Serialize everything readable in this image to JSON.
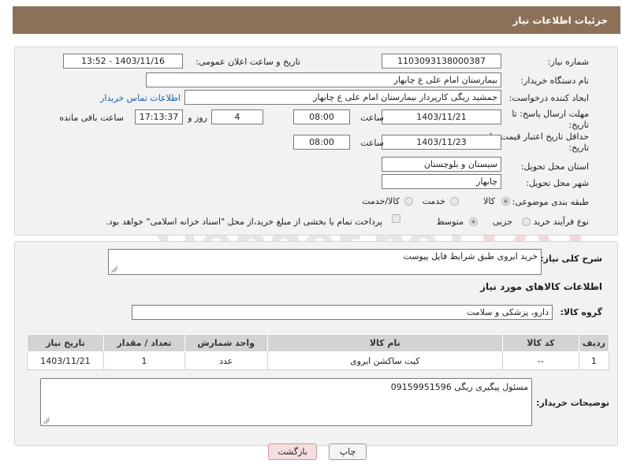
{
  "page": {
    "title": "جزئیات اطلاعات نیاز"
  },
  "form": {
    "need_number_label": "شماره نیاز:",
    "need_number": "1103093138000387",
    "announce_label": "تاریخ و ساعت اعلان عمومی:",
    "announce_value": "1403/11/16 - 13:52",
    "buyer_org_label": "نام دستگاه خریدار:",
    "buyer_org": "بیمارستان امام علی  ع  چابهار",
    "creator_label": "ایجاد کننده درخواست:",
    "creator": "جمشید ریگی کارپرداز بیمارستان امام علی  ع  چابهار",
    "contact_link": "اطلاعات تماس خریدار",
    "reply_deadline_label_1": "مهلت ارسال پاسخ: تا",
    "reply_deadline_label_2": "تاریخ:",
    "reply_date": "1403/11/21",
    "time_label": "ساعت",
    "reply_time": "08:00",
    "days_value": "4",
    "days_label": "روز و",
    "remaining_time": "17:13:37",
    "remaining_label": "ساعت باقی مانده",
    "price_deadline_label_1": "حداقل تاریخ اعتبار قیمت: تا",
    "price_deadline_label_2": "تاریخ:",
    "price_date": "1403/11/23",
    "price_time": "08:00",
    "province_label": "استان محل تحویل:",
    "province": "سیستان و بلوچستان",
    "city_label": "شهر محل تحویل:",
    "city": "چابهار",
    "category_label": "طبقه بندی موضوعی:",
    "category_options": [
      "کالا",
      "خدمت",
      "کالا/خدمت"
    ],
    "purchase_type_label": "نوع فرآیند خرید :",
    "purchase_options": [
      "جزیی",
      "متوسط"
    ],
    "payment_note": "پرداخت تمام یا بخشی از مبلغ خرید،از محل \"اسناد خزانه اسلامی\" خواهد بود."
  },
  "details": {
    "summary_label": "شرح کلی نیاز:",
    "summary": "خرید ایروی طبق شرایط فایل پیوست",
    "goods_info_title": "اطلاعات کالاهای مورد نیاز",
    "goods_group_label": "گروه کالا:",
    "goods_group": "دارو، پزشکی و سلامت",
    "table": {
      "headers": [
        "ردیف",
        "کد کالا",
        "نام کالا",
        "واحد شمارش",
        "تعداد / مقدار",
        "تاریخ نیاز"
      ],
      "rows": [
        [
          "1",
          "--",
          "کیت ساکشن ایروی",
          "عدد",
          "1",
          "1403/11/21"
        ]
      ]
    },
    "buyer_notes_label": "توضیحات خریدار:",
    "buyer_notes": "مسئول پیگیری ریگی 09159951596"
  },
  "buttons": {
    "print": "چاپ",
    "back": "بازگشت"
  },
  "watermark": {
    "text": "AriaTender.neT"
  },
  "colors": {
    "header_bg": "#8c7158",
    "panel_bg": "#f2f2f2",
    "link": "#1a5fb4",
    "back_button_bg": "#f6dede"
  }
}
